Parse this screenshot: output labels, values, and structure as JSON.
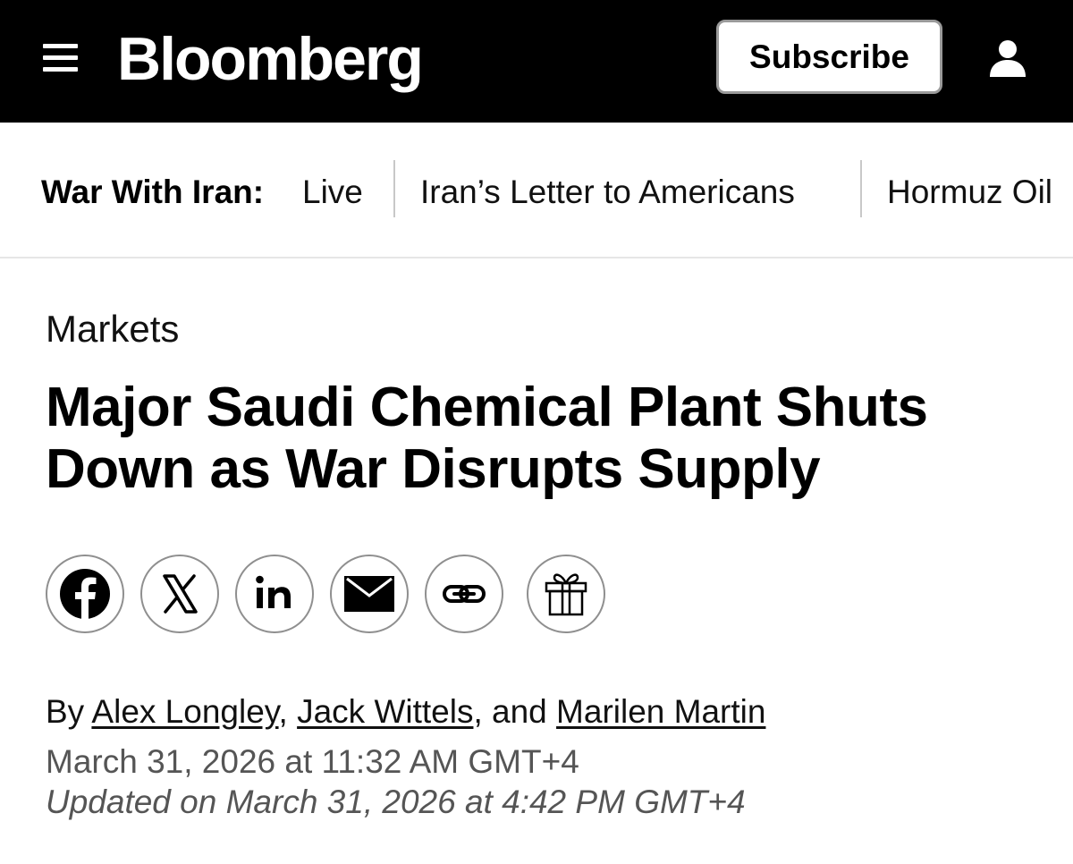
{
  "header": {
    "logo": "Bloomberg",
    "subscribe_label": "Subscribe",
    "menu_icon": "hamburger-menu-icon",
    "account_icon": "user-icon",
    "background": "#000000"
  },
  "topic_nav": {
    "label": "War With Iran:",
    "links": [
      "Live",
      "Iran’s Letter to Americans",
      "Hormuz Oil"
    ]
  },
  "article": {
    "section": "Markets",
    "headline_line1": "Major Saudi Chemical Plant Shuts",
    "headline_line2": "Down as War Disrupts Supply",
    "share_icons": [
      "facebook-icon",
      "x-icon",
      "linkedin-icon",
      "email-icon",
      "link-icon",
      "gift-icon"
    ],
    "byline": {
      "prefix": "By ",
      "authors": [
        "Alex Longley",
        "Jack Wittels",
        "Marilen Martin"
      ],
      "sep1": ", ",
      "sep2": ", and "
    },
    "published": "March 31, 2026 at 11:32 AM GMT+4",
    "updated": "Updated on March 31, 2026 at 4:42 PM GMT+4"
  }
}
